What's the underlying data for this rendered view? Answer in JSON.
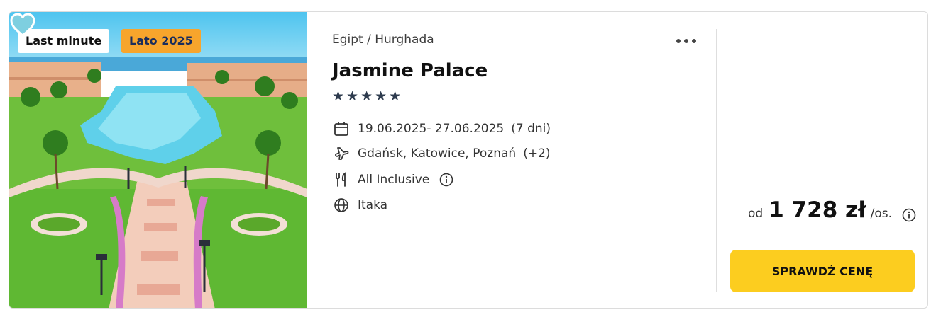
{
  "photo": {
    "badges": {
      "last_minute": "Last minute",
      "season": "Lato 2025"
    }
  },
  "offer": {
    "breadcrumb": "Egipt / Hurghada",
    "title": "Jasmine Palace",
    "stars": "★★★★★",
    "rating_stars": 5,
    "dates": "19.06.2025- 27.06.2025",
    "duration": "(7 dni)",
    "departure": "Gdańsk, Katowice, Poznań",
    "departure_more": "(+2)",
    "board": "All Inclusive",
    "operator": "Itaka"
  },
  "price": {
    "prefix": "od",
    "amount": "1 728 zł",
    "suffix": "/os."
  },
  "cta": {
    "label": "SPRAWDŹ CENĘ"
  },
  "colors": {
    "season_badge": "#f7a52c",
    "cta": "#fccd1f",
    "stars": "#2e3b4e",
    "heart": "#7ecfe0"
  },
  "icons": [
    "heart-icon",
    "more-icon",
    "calendar-icon",
    "plane-icon",
    "cutlery-icon",
    "info-icon",
    "globe-icon"
  ]
}
